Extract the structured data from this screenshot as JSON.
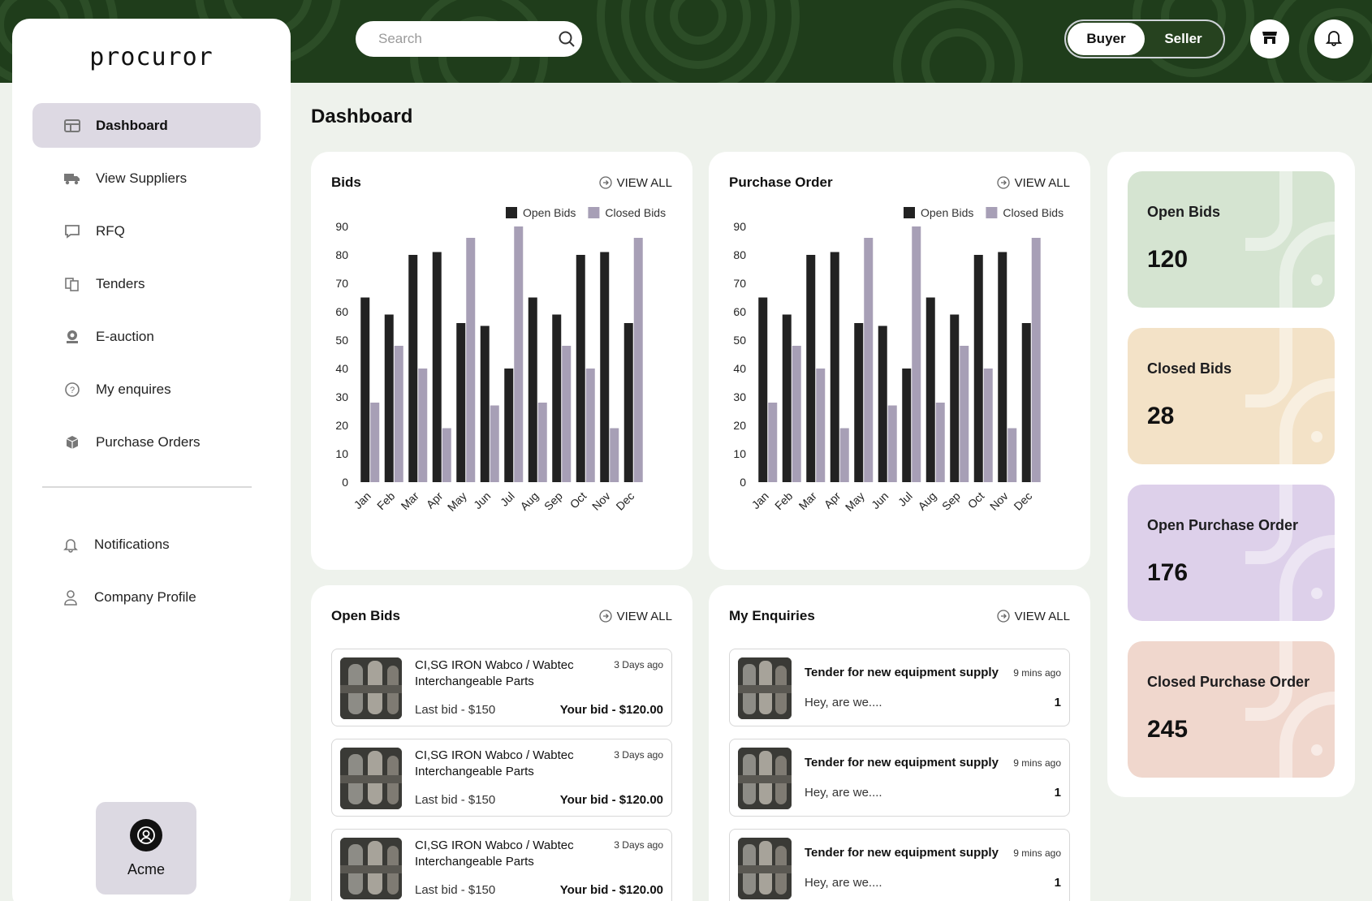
{
  "brand": {
    "logo": "procuror"
  },
  "header": {
    "search_placeholder": "Search",
    "roles": [
      "Buyer",
      "Seller"
    ],
    "active_role": "Buyer",
    "icons": [
      "store-icon",
      "bell-icon"
    ]
  },
  "sidebar": {
    "items": [
      {
        "label": "Dashboard",
        "icon": "table-icon",
        "active": true
      },
      {
        "label": "View Suppliers",
        "icon": "truck-icon",
        "active": false
      },
      {
        "label": "RFQ",
        "icon": "chat-icon",
        "active": false
      },
      {
        "label": "Tenders",
        "icon": "documents-icon",
        "active": false
      },
      {
        "label": "E-auction",
        "icon": "auction-icon",
        "active": false
      },
      {
        "label": "My enquires",
        "icon": "question-icon",
        "active": false
      },
      {
        "label": "Purchase Orders",
        "icon": "box-icon",
        "active": false
      }
    ],
    "secondary": [
      {
        "label": "Notifications",
        "icon": "bell-icon"
      },
      {
        "label": "Company Profile",
        "icon": "user-icon"
      }
    ],
    "account": {
      "name": "Acme"
    }
  },
  "page_title": "Dashboard",
  "view_all": "VIEW ALL",
  "colors": {
    "open": "#222222",
    "closed": "#a79fb6",
    "header": "#1f3d1b",
    "active_nav": "#ddd9e3"
  },
  "chart_data": [
    {
      "type": "bar",
      "title": "Bids",
      "categories": [
        "Jan",
        "Feb",
        "Mar",
        "Apr",
        "May",
        "Jun",
        "Jul",
        "Aug",
        "Sep",
        "Oct",
        "Nov",
        "Dec"
      ],
      "series": [
        {
          "name": "Open Bids",
          "values": [
            65,
            59,
            80,
            81,
            56,
            55,
            40,
            65,
            59,
            80,
            81,
            56
          ]
        },
        {
          "name": "Closed Bids",
          "values": [
            28,
            48,
            40,
            19,
            86,
            27,
            90,
            28,
            48,
            40,
            19,
            86
          ]
        }
      ],
      "ylim": [
        0,
        90
      ],
      "yticks": [
        0,
        10,
        20,
        30,
        40,
        50,
        60,
        70,
        80,
        90
      ],
      "legend": "top-right"
    },
    {
      "type": "bar",
      "title": "Purchase Order",
      "categories": [
        "Jan",
        "Feb",
        "Mar",
        "Apr",
        "May",
        "Jun",
        "Jul",
        "Aug",
        "Sep",
        "Oct",
        "Nov",
        "Dec"
      ],
      "series": [
        {
          "name": "Open Bids",
          "values": [
            65,
            59,
            80,
            81,
            56,
            55,
            40,
            65,
            59,
            80,
            81,
            56
          ]
        },
        {
          "name": "Closed Bids",
          "values": [
            28,
            48,
            40,
            19,
            86,
            27,
            90,
            28,
            48,
            40,
            19,
            86
          ]
        }
      ],
      "ylim": [
        0,
        90
      ],
      "yticks": [
        0,
        10,
        20,
        30,
        40,
        50,
        60,
        70,
        80,
        90
      ],
      "legend": "top-right"
    }
  ],
  "open_bids": {
    "title": "Open Bids",
    "items": [
      {
        "title": "CI,SG IRON Wabco / Wabtec Interchangeable Parts",
        "time": "3 Days ago",
        "last_bid": "Last bid - $150",
        "your_bid": "Your bid - $120.00"
      },
      {
        "title": "CI,SG IRON Wabco / Wabtec Interchangeable Parts",
        "time": "3 Days ago",
        "last_bid": "Last bid - $150",
        "your_bid": "Your bid - $120.00"
      },
      {
        "title": "CI,SG IRON Wabco / Wabtec Interchangeable Parts",
        "time": "3 Days ago",
        "last_bid": "Last bid - $150",
        "your_bid": "Your bid - $120.00"
      }
    ]
  },
  "enquiries": {
    "title": "My Enquiries",
    "items": [
      {
        "title": "Tender for new equipment supply",
        "time": "9 mins ago",
        "message": "Hey, are we....",
        "count": "1"
      },
      {
        "title": "Tender for new equipment supply",
        "time": "9 mins ago",
        "message": "Hey, are we....",
        "count": "1"
      },
      {
        "title": "Tender for new equipment supply",
        "time": "9 mins ago",
        "message": "Hey, are we....",
        "count": "1"
      }
    ]
  },
  "stats": [
    {
      "label": "Open Bids",
      "value": "120",
      "color": "#d5e4d1"
    },
    {
      "label": "Closed Bids",
      "value": "28",
      "color": "#f3e2c7"
    },
    {
      "label": "Open Purchase Order",
      "value": "176",
      "color": "#ddd0ea"
    },
    {
      "label": "Closed Purchase Order",
      "value": "245",
      "color": "#f0d7cd"
    }
  ]
}
